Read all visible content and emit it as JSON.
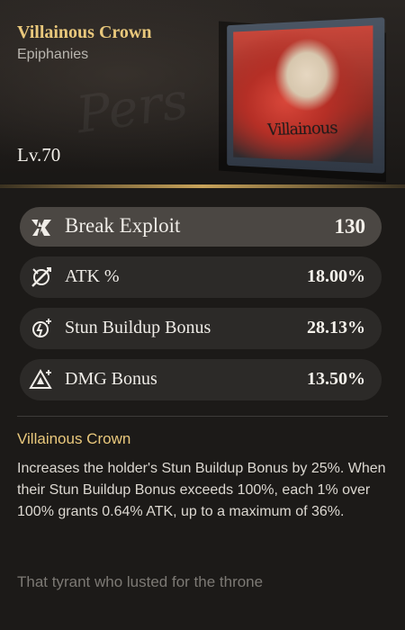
{
  "header": {
    "title": "Villainous Crown",
    "subtitle": "Epiphanies",
    "level": "Lv.70",
    "book_cover_text": "Villainous"
  },
  "stats": [
    {
      "label": "Break Exploit",
      "value": "130",
      "icon": "break-exploit-icon"
    },
    {
      "label": "ATK %",
      "value": "18.00%",
      "icon": "atk-icon"
    },
    {
      "label": "Stun Buildup Bonus",
      "value": "28.13%",
      "icon": "stun-buildup-icon"
    },
    {
      "label": "DMG Bonus",
      "value": "13.50%",
      "icon": "dmg-bonus-icon"
    }
  ],
  "description": {
    "title": "Villainous Crown",
    "text": "Increases the holder's Stun Buildup Bonus by 25%. When their Stun Buildup Bonus exceeds 100%, each 1% over 100% grants 0.64% ATK, up to a maximum of 36%.",
    "lore": "That tyrant who lusted for the throne"
  },
  "colors": {
    "accent_gold": "#e9c87c",
    "panel_bg": "#1c1a18"
  }
}
